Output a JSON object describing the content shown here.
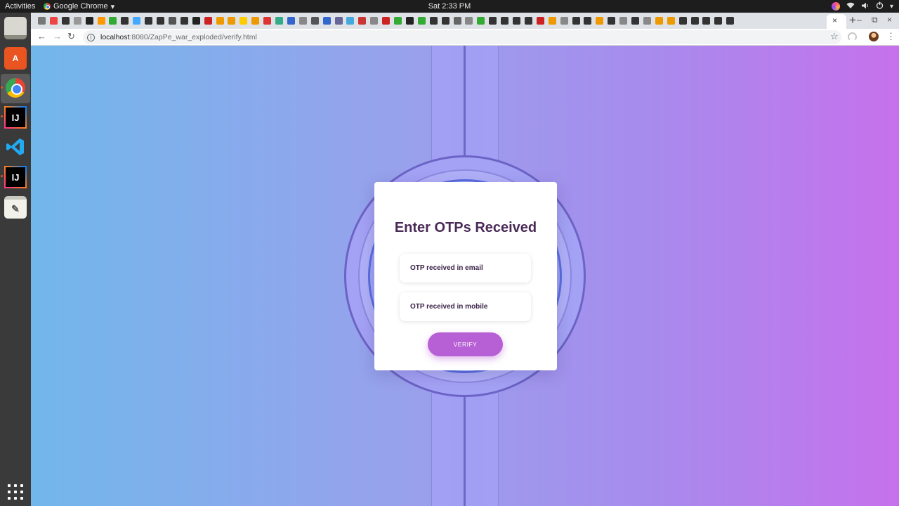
{
  "system": {
    "activities_label": "Activities",
    "app_name": "Google Chrome",
    "app_menu_arrow": "▾",
    "clock": "Sat  2:33 PM"
  },
  "tray": {
    "wifi_icon": "wifi-icon",
    "volume_icon": "volume-icon",
    "power_icon": "power-icon",
    "caret": "▾"
  },
  "dock": {
    "items": [
      {
        "name": "files",
        "label": ""
      },
      {
        "name": "software",
        "label": "A"
      },
      {
        "name": "chrome",
        "label": ""
      },
      {
        "name": "intellij",
        "label": "IJ"
      },
      {
        "name": "vscode",
        "label": "❮❯"
      },
      {
        "name": "intellij-2",
        "label": "IJ"
      },
      {
        "name": "text-editor",
        "label": "✎"
      }
    ]
  },
  "browser": {
    "tab_close": "×",
    "new_tab": "+",
    "window_min": "–",
    "window_max": "⧉",
    "window_close": "×",
    "back": "←",
    "forward": "→",
    "reload": "↻",
    "url_host": "localhost",
    "url_path": ":8080/ZapPe_war_exploded/verify.html",
    "star": "☆",
    "menu": "⋮",
    "info": "i"
  },
  "page": {
    "title": "Enter OTPs Received",
    "email_otp_placeholder": "OTP received in email",
    "mobile_otp_placeholder": "OTP received in mobile",
    "verify_label": "VERIFY"
  },
  "colors": {
    "gradient_left": "#72b7ec",
    "gradient_right": "#c671eb",
    "button": "#b75fd4",
    "title": "#4a2a57"
  }
}
